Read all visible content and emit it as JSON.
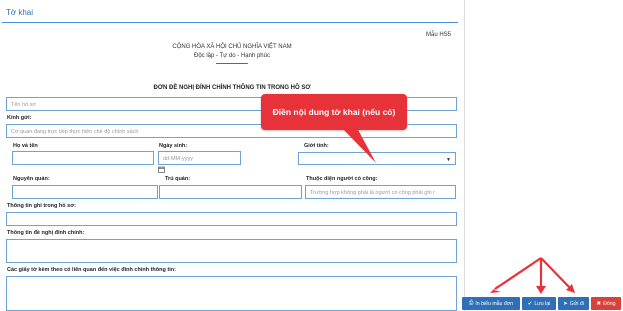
{
  "panel": {
    "title": "Tờ khai"
  },
  "form_code": "Mẫu HS5",
  "header": {
    "nation": "CỘNG HÒA XÃ HỘI CHỦ NGHĨA VIỆT NAM",
    "motto": "Độc lập - Tự do - Hạnh phúc"
  },
  "form_title": "ĐƠN ĐỀ NGHỊ ĐÍNH CHÍNH THÔNG TIN TRONG HỒ SƠ",
  "fields": {
    "file_name": {
      "placeholder": "Tên hồ sơ"
    },
    "send_to": {
      "label": "Kính gửi:",
      "placeholder": "Cơ quan đang trực tiếp thực hiện chế độ chính sách"
    },
    "full_name": {
      "label": "Họ và tên"
    },
    "birth_date": {
      "label": "Ngày sinh:",
      "placeholder": "dd-MM-yyyy"
    },
    "gender": {
      "label": "Giới tính:"
    },
    "hometown": {
      "label": "Nguyên quán:"
    },
    "residence": {
      "label": "Trú quán:"
    },
    "merit_type": {
      "label": "Thuộc diện người có công:",
      "placeholder": "Trường hợp không phải là người có công phải ghi r"
    },
    "recorded_info": {
      "label": "Thông tin ghi trong hồ sơ:"
    },
    "correction_info": {
      "label": "Thông tin đề nghị đính chính:"
    },
    "attached_docs": {
      "label": "Các giấy tờ kèm theo có liên quan đến việc đính chính thông tin:"
    }
  },
  "callout": {
    "text": "Điền nội dung tờ khai (nếu có)",
    "color": "#e8323a"
  },
  "buttons": {
    "print": {
      "label": "In biểu mẫu đơn",
      "icon": "printer-icon",
      "color": "#2e6fb6"
    },
    "save": {
      "label": "Lưu lại",
      "icon": "check-icon",
      "color": "#2e6fb6"
    },
    "send": {
      "label": "Gửi đi",
      "icon": "send-icon",
      "color": "#2e6fb6"
    },
    "close": {
      "label": "Đóng",
      "icon": "close-icon",
      "color": "#d9413a"
    }
  },
  "arrows": {
    "color": "#e8323a"
  }
}
